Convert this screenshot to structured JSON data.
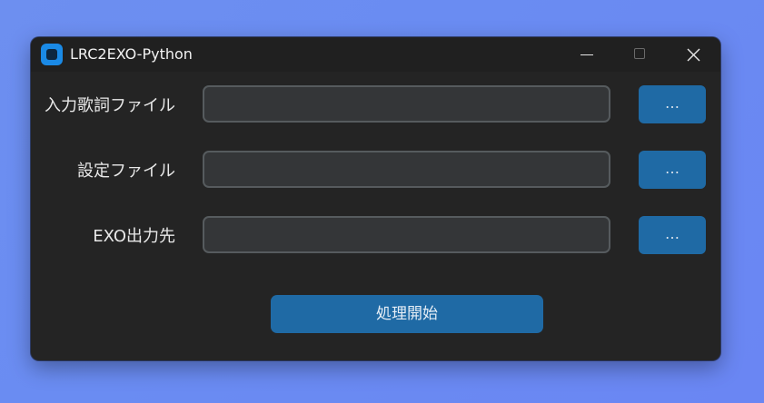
{
  "window": {
    "title": "LRC2EXO-Python",
    "controls": [
      "minimize-icon",
      "maximize-icon",
      "close-icon"
    ]
  },
  "rows": [
    {
      "label": "入力歌詞ファイル",
      "value": "",
      "button": "…"
    },
    {
      "label": "設定ファイル",
      "value": "",
      "button": "…"
    },
    {
      "label": "EXO出力先",
      "value": "",
      "button": "…"
    }
  ],
  "actions": {
    "start_label": "処理開始"
  },
  "colors": {
    "window_bg": "#242424",
    "field_bg": "#343638",
    "field_border": "#565b5e",
    "accent": "#1f6aa5",
    "desktop": "#6a8cf2"
  }
}
